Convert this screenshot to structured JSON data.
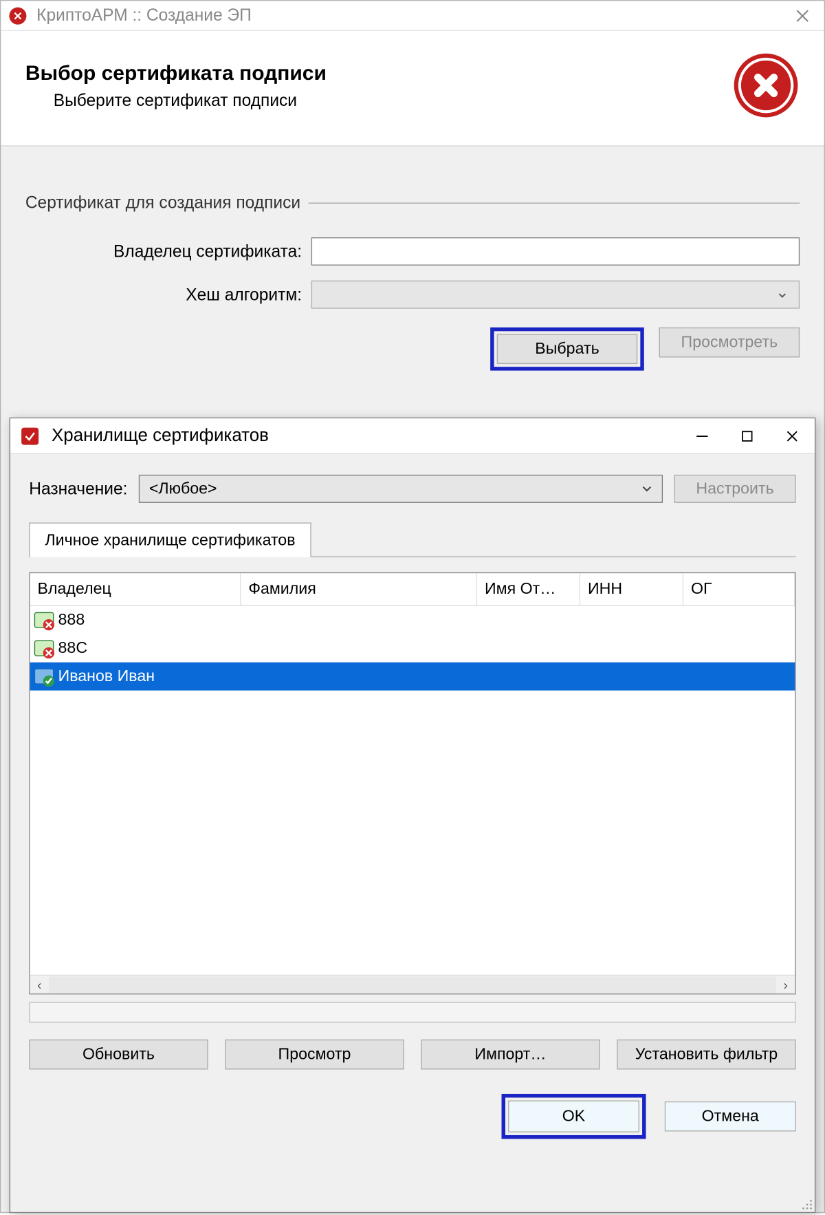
{
  "main": {
    "title": "КриптоАРМ :: Создание ЭП",
    "header_title": "Выбор сертификата подписи",
    "header_sub": "Выберите сертификат подписи",
    "legend": "Сертификат для создания подписи",
    "label_owner": "Владелец сертификата:",
    "label_hash": "Хеш алгоритм:",
    "owner_value": "",
    "hash_value": "",
    "btn_select": "Выбрать",
    "btn_view": "Просмотреть"
  },
  "store": {
    "title": "Хранилище сертификатов",
    "purpose_label": "Назначение:",
    "purpose_value": "<Любое>",
    "btn_configure": "Настроить",
    "tab_label": "Личное хранилище сертификатов",
    "columns": {
      "owner": "Владелец",
      "surname": "Фамилия",
      "name": "Имя От…",
      "inn": "ИНН",
      "ogrn": "ОГ"
    },
    "rows": [
      {
        "owner": "888",
        "status": "invalid",
        "selected": false
      },
      {
        "owner": "88C",
        "status": "invalid",
        "selected": false
      },
      {
        "owner": "Иванов Иван",
        "status": "valid",
        "selected": true
      }
    ],
    "buttons": {
      "refresh": "Обновить",
      "view": "Просмотр",
      "import": "Импорт…",
      "filter": "Установить фильтр",
      "ok": "OK",
      "cancel": "Отмена"
    }
  }
}
